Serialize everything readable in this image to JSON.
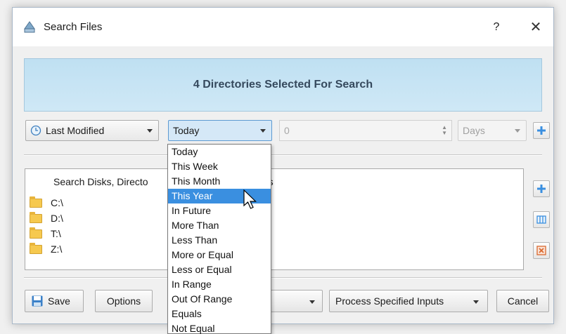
{
  "window": {
    "title": "Search Files",
    "help": "?",
    "close": "✕"
  },
  "banner": {
    "text": "4 Directories Selected For Search"
  },
  "filter": {
    "field": "Last Modified",
    "condition": "Today",
    "value": "0",
    "unit": "Days"
  },
  "dropdown": {
    "items": [
      "Today",
      "This Week",
      "This Month",
      "This Year",
      "In Future",
      "More Than",
      "Less Than",
      "More or Equal",
      "Less or Equal",
      "In Range",
      "Out Of Range",
      "Equals",
      "Not Equal"
    ],
    "highlighted": "This Year"
  },
  "list": {
    "header_left": "Search Disks, Directo",
    "header_right": "hares",
    "items": [
      "C:\\",
      "D:\\",
      "T:\\",
      "Z:\\"
    ]
  },
  "bottom": {
    "save": "Save",
    "options": "Options",
    "process": "Process Specified Inputs",
    "cancel": "Cancel"
  },
  "colors": {
    "accent": "#3a8fe0",
    "banner": "#cfe8f6",
    "banner_text": "#35495d"
  },
  "icons": [
    "search-files-app-icon",
    "clock-icon",
    "add-icon",
    "select-all-icon",
    "remove-icon",
    "save-icon"
  ]
}
